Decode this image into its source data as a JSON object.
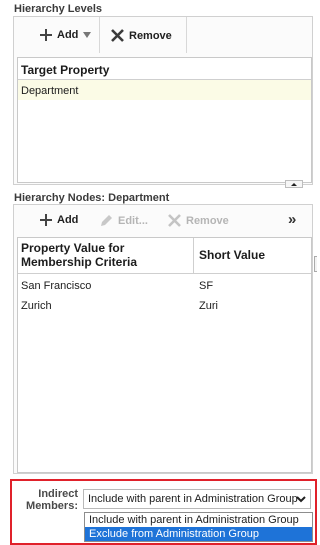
{
  "hierarchy_levels": {
    "title": "Hierarchy Levels",
    "toolbar": {
      "add_label": "Add",
      "remove_label": "Remove"
    },
    "table": {
      "header": "Target Property",
      "rows": [
        "Department"
      ]
    }
  },
  "hierarchy_nodes": {
    "title": "Hierarchy Nodes: Department",
    "toolbar": {
      "add_label": "Add",
      "edit_label": "Edit...",
      "remove_label": "Remove"
    },
    "table": {
      "headers": [
        "Property Value for Membership Criteria",
        "Short Value"
      ],
      "rows": [
        {
          "value": "San Francisco",
          "short": "SF"
        },
        {
          "value": "Zurich",
          "short": "Zuri"
        }
      ]
    }
  },
  "indirect_members": {
    "label": "Indirect Members:",
    "selected": "Include with parent in Administration Group",
    "options": [
      "Include with parent in Administration Group",
      "Exclude from Administration Group"
    ],
    "highlighted_option": "Exclude from Administration Group"
  },
  "colors": {
    "selected_row": "#fbfbe6",
    "highlight_border": "#e0212a",
    "dropdown_selected": "#1e73d8"
  }
}
